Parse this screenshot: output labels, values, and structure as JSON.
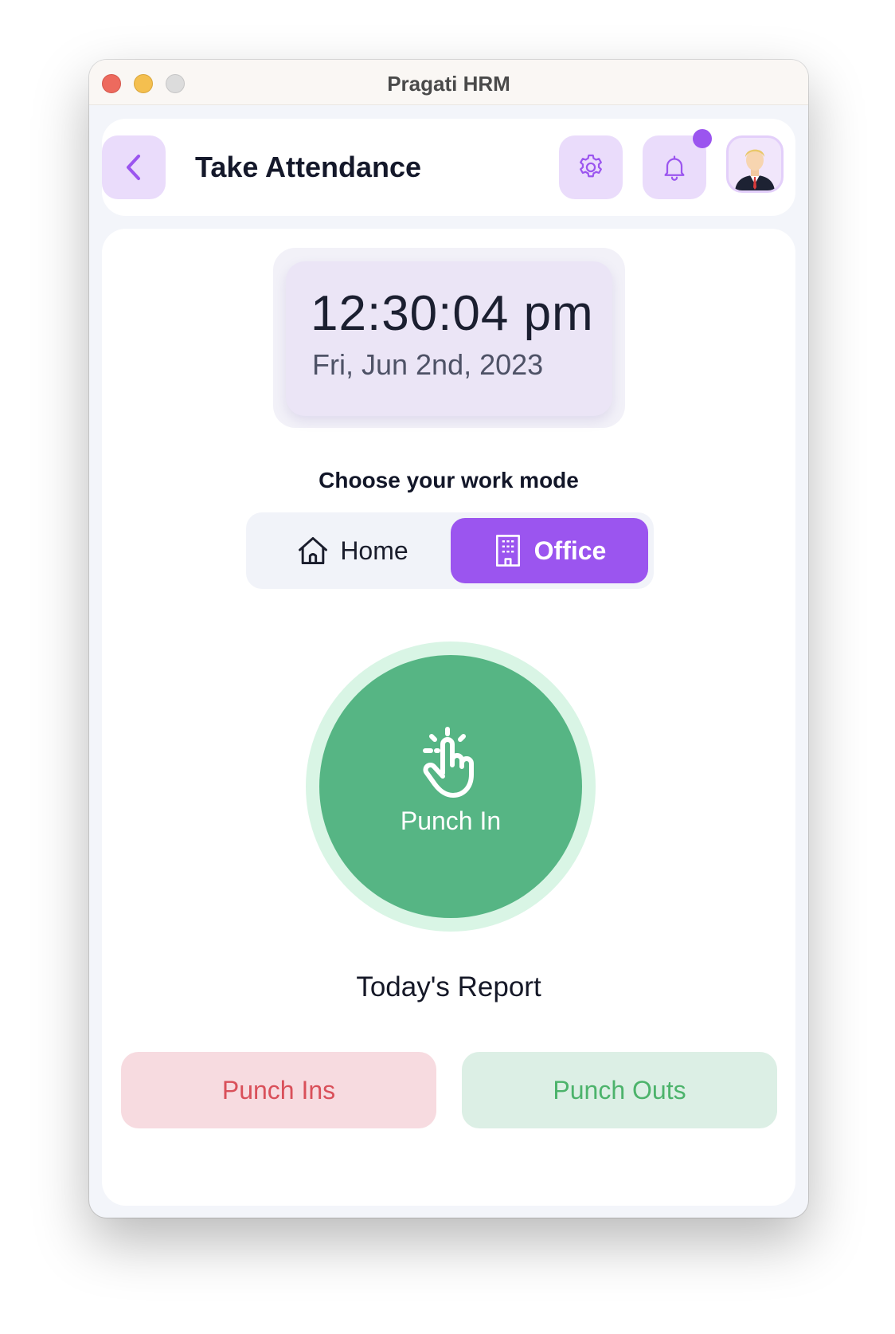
{
  "window": {
    "title": "Pragati HRM"
  },
  "header": {
    "title": "Take Attendance",
    "back_icon": "chevron-left-icon",
    "settings_icon": "gear-icon",
    "notifications_icon": "bell-icon",
    "has_notification": true
  },
  "clock": {
    "time": "12:30:04 pm",
    "date": "Fri, Jun 2nd, 2023"
  },
  "work_mode": {
    "label": "Choose your work mode",
    "options": [
      {
        "label": "Home",
        "icon": "home-icon",
        "selected": false
      },
      {
        "label": "Office",
        "icon": "building-icon",
        "selected": true
      }
    ]
  },
  "punch": {
    "label": "Punch In",
    "icon": "hand-tap-icon"
  },
  "report": {
    "title": "Today's Report",
    "punch_ins_label": "Punch Ins",
    "punch_outs_label": "Punch Outs"
  },
  "colors": {
    "accent": "#9b55ef",
    "punch_green": "#56b584",
    "punch_ins_text": "#d9505a",
    "punch_outs_text": "#4cb36b"
  }
}
